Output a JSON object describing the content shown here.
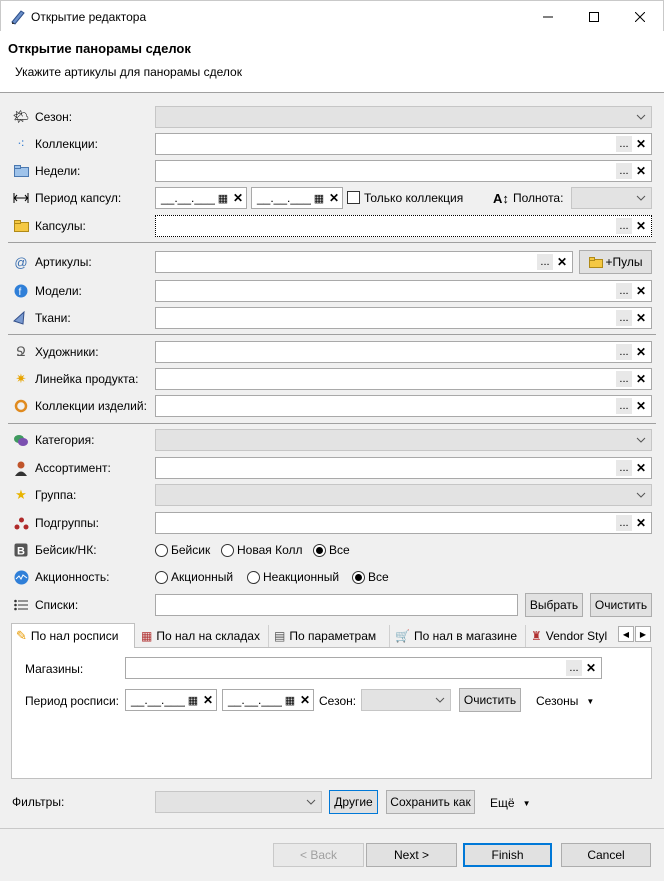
{
  "window": {
    "title": "Открытие редактора"
  },
  "header": {
    "title": "Открытие панорамы сделок",
    "subtitle": "Укажите артикулы для панорамы сделок"
  },
  "fields": {
    "season": "Сезон:",
    "collections": "Коллекции:",
    "weeks": "Недели:",
    "capsule_period": "Период капсул:",
    "only_collection": "Только коллекция",
    "completeness": "Полнота:",
    "capsules": "Капсулы:",
    "articles": "Артикулы:",
    "pools_button": "+Пулы",
    "models": "Модели:",
    "fabrics": "Ткани:",
    "artists": "Художники:",
    "product_line": "Линейка продукта:",
    "item_collections": "Коллекции изделий:",
    "category": "Категория:",
    "assortment": "Ассортимент:",
    "group": "Группа:",
    "subgroups": "Подгруппы:",
    "basic_nk": "Бейсик/НК:",
    "promo": "Акционность:",
    "lists": "Списки:"
  },
  "date_placeholder": "__.__.____",
  "ellipsis": "...",
  "clear_x": "✕",
  "basic_options": [
    "Бейсик",
    "Новая Колл",
    "Все"
  ],
  "promo_options": [
    "Акционный",
    "Неакционный",
    "Все"
  ],
  "lists_buttons": {
    "select": "Выбрать",
    "clear": "Очистить"
  },
  "tabs": [
    "По нал росписи",
    "По нал на складах",
    "По параметрам",
    "По нал в магазине",
    "Vendor Styl"
  ],
  "tab_panel": {
    "stores": "Магазины:",
    "schedule_period": "Период росписи:",
    "season": "Сезон:",
    "clear": "Очистить",
    "seasons": "Сезоны"
  },
  "filters": {
    "label": "Фильтры:",
    "others": "Другие",
    "save_as": "Сохранить как",
    "more": "Ещё"
  },
  "footer": {
    "back": "< Back",
    "next": "Next >",
    "finish": "Finish",
    "cancel": "Cancel"
  },
  "colors": {
    "accent": "#0078d7",
    "disabled_field": "#e3e3e3",
    "dialog_bg": "#f0f0f0"
  }
}
